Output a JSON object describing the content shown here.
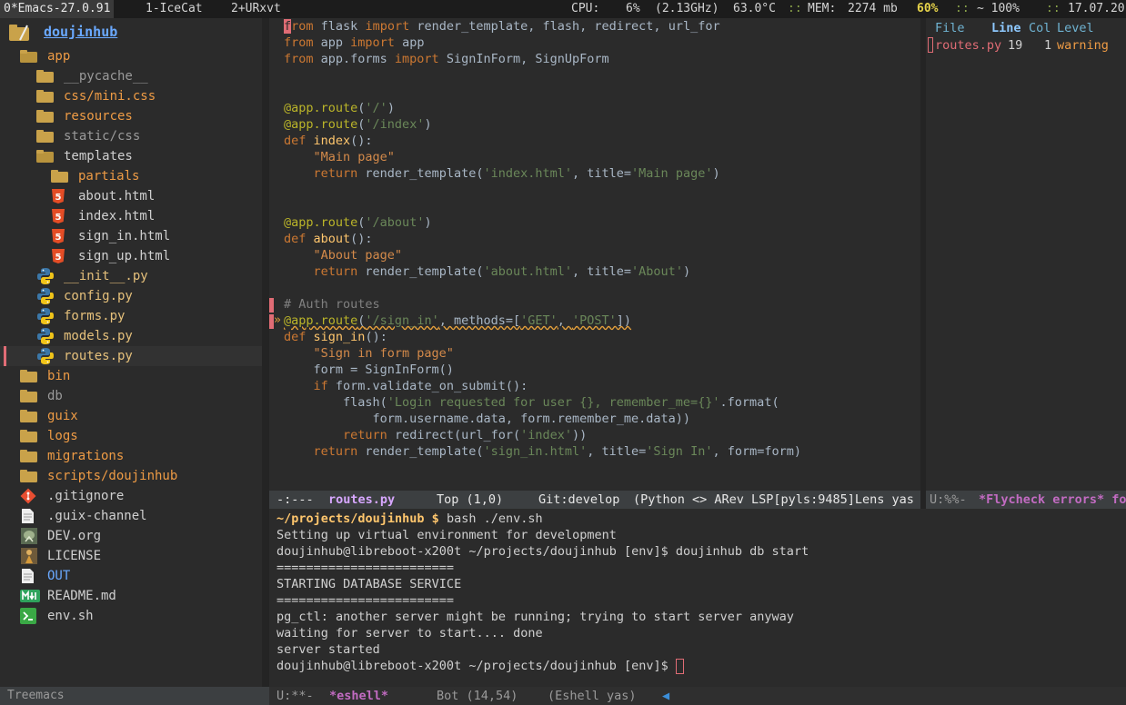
{
  "topbar": {
    "workspaces": [
      {
        "label": "0*Emacs-27.0.91",
        "active": true
      },
      {
        "label": "1-IceCat",
        "active": false
      },
      {
        "label": "2+URxvt",
        "active": false
      }
    ],
    "cpu_label": "CPU:",
    "cpu_value": "6%",
    "cpu_freq": "(2.13GHz)",
    "temp": "63.0°C",
    "mem_label": "MEM:",
    "mem_value": "2274 mb",
    "battery_value": "60%",
    "volume": "~ 100%",
    "date": "17.07.20"
  },
  "treemacs": {
    "root": "doujinhub",
    "items": [
      {
        "label": "app",
        "depth": 1,
        "icon": "folder-open-icon",
        "color": "orange"
      },
      {
        "label": "__pycache__",
        "depth": 2,
        "icon": "folder-icon",
        "color": "gray"
      },
      {
        "label": "css/mini.css",
        "depth": 2,
        "icon": "folder-icon",
        "color": "orange"
      },
      {
        "label": "resources",
        "depth": 2,
        "icon": "folder-icon",
        "color": "orange"
      },
      {
        "label": "static/css",
        "depth": 2,
        "icon": "folder-icon",
        "color": "gray"
      },
      {
        "label": "templates",
        "depth": 2,
        "icon": "folder-open-icon",
        "color": "light"
      },
      {
        "label": "partials",
        "depth": 3,
        "icon": "folder-icon",
        "color": "orange"
      },
      {
        "label": "about.html",
        "depth": 3,
        "icon": "html5-icon",
        "color": "light"
      },
      {
        "label": "index.html",
        "depth": 3,
        "icon": "html5-icon",
        "color": "light"
      },
      {
        "label": "sign_in.html",
        "depth": 3,
        "icon": "html5-icon",
        "color": "light"
      },
      {
        "label": "sign_up.html",
        "depth": 3,
        "icon": "html5-icon",
        "color": "light"
      },
      {
        "label": "__init__.py",
        "depth": 2,
        "icon": "python-icon",
        "color": "yellow"
      },
      {
        "label": "config.py",
        "depth": 2,
        "icon": "python-icon",
        "color": "yellow"
      },
      {
        "label": "forms.py",
        "depth": 2,
        "icon": "python-icon",
        "color": "yellow"
      },
      {
        "label": "models.py",
        "depth": 2,
        "icon": "python-icon",
        "color": "yellow"
      },
      {
        "label": "routes.py",
        "depth": 2,
        "icon": "python-icon",
        "color": "yellow",
        "selected": true
      },
      {
        "label": "bin",
        "depth": 1,
        "icon": "folder-icon",
        "color": "orange"
      },
      {
        "label": "db",
        "depth": 1,
        "icon": "folder-icon",
        "color": "gray"
      },
      {
        "label": "guix",
        "depth": 1,
        "icon": "folder-icon",
        "color": "orange"
      },
      {
        "label": "logs",
        "depth": 1,
        "icon": "folder-icon",
        "color": "orange"
      },
      {
        "label": "migrations",
        "depth": 1,
        "icon": "folder-icon",
        "color": "orange"
      },
      {
        "label": "scripts/doujinhub",
        "depth": 1,
        "icon": "folder-icon",
        "color": "orange"
      },
      {
        "label": ".gitignore",
        "depth": 1,
        "icon": "git-icon",
        "color": "light"
      },
      {
        "label": ".guix-channel",
        "depth": 1,
        "icon": "document-icon",
        "color": "light"
      },
      {
        "label": "DEV.org",
        "depth": 1,
        "icon": "org-icon",
        "color": "light"
      },
      {
        "label": "LICENSE",
        "depth": 1,
        "icon": "license-icon",
        "color": "light"
      },
      {
        "label": "OUT",
        "depth": 1,
        "icon": "document-icon",
        "color": "blue"
      },
      {
        "label": "README.md",
        "depth": 1,
        "icon": "markdown-icon",
        "color": "light"
      },
      {
        "label": "env.sh",
        "depth": 1,
        "icon": "terminal-icon",
        "color": "light"
      }
    ],
    "modeline": "Treemacs"
  },
  "editor": {
    "lines": [
      [
        {
          "t": "f",
          "c": "cursor"
        },
        {
          "t": "rom",
          "c": "kw"
        },
        {
          "t": " flask ",
          "c": "id"
        },
        {
          "t": "import",
          "c": "kw"
        },
        {
          "t": " render_template, flash, redirect, url_for",
          "c": "id"
        }
      ],
      [
        {
          "t": "from",
          "c": "kw"
        },
        {
          "t": " app ",
          "c": "id"
        },
        {
          "t": "import",
          "c": "kw"
        },
        {
          "t": " app",
          "c": "id"
        }
      ],
      [
        {
          "t": "from",
          "c": "kw"
        },
        {
          "t": " app.forms ",
          "c": "id"
        },
        {
          "t": "import",
          "c": "kw"
        },
        {
          "t": " SignInForm, SignUpForm",
          "c": "id"
        }
      ],
      [],
      [],
      [
        {
          "t": "@app.route",
          "c": "dec"
        },
        {
          "t": "(",
          "c": "id"
        },
        {
          "t": "'/'",
          "c": "str"
        },
        {
          "t": ")",
          "c": "id"
        }
      ],
      [
        {
          "t": "@app.route",
          "c": "dec"
        },
        {
          "t": "(",
          "c": "id"
        },
        {
          "t": "'/index'",
          "c": "str"
        },
        {
          "t": ")",
          "c": "id"
        }
      ],
      [
        {
          "t": "def",
          "c": "kw"
        },
        {
          "t": " ",
          "c": "id"
        },
        {
          "t": "index",
          "c": "fn"
        },
        {
          "t": "():",
          "c": "id"
        }
      ],
      [
        {
          "t": "    \"Main page\"",
          "c": "doc"
        }
      ],
      [
        {
          "t": "    ",
          "c": "id"
        },
        {
          "t": "return",
          "c": "kw"
        },
        {
          "t": " render_template(",
          "c": "id"
        },
        {
          "t": "'index.html'",
          "c": "str"
        },
        {
          "t": ", title=",
          "c": "id"
        },
        {
          "t": "'Main page'",
          "c": "str"
        },
        {
          "t": ")",
          "c": "id"
        }
      ],
      [],
      [],
      [
        {
          "t": "@app.route",
          "c": "dec"
        },
        {
          "t": "(",
          "c": "id"
        },
        {
          "t": "'/about'",
          "c": "str"
        },
        {
          "t": ")",
          "c": "id"
        }
      ],
      [
        {
          "t": "def",
          "c": "kw"
        },
        {
          "t": " ",
          "c": "id"
        },
        {
          "t": "about",
          "c": "fn"
        },
        {
          "t": "():",
          "c": "id"
        }
      ],
      [
        {
          "t": "    \"About page\"",
          "c": "doc"
        }
      ],
      [
        {
          "t": "    ",
          "c": "id"
        },
        {
          "t": "return",
          "c": "kw"
        },
        {
          "t": " render_template(",
          "c": "id"
        },
        {
          "t": "'about.html'",
          "c": "str"
        },
        {
          "t": ", title=",
          "c": "id"
        },
        {
          "t": "'About'",
          "c": "str"
        },
        {
          "t": ")",
          "c": "id"
        }
      ],
      [],
      [
        {
          "t": "# Auth routes",
          "c": "cmt"
        }
      ],
      [
        {
          "t": "@app.route",
          "c": "dec warn"
        },
        {
          "t": "(",
          "c": "id warn"
        },
        {
          "t": "'/sign_in'",
          "c": "str warn"
        },
        {
          "t": ", methods=[",
          "c": "id warn"
        },
        {
          "t": "'GET'",
          "c": "str warn"
        },
        {
          "t": ", ",
          "c": "id warn"
        },
        {
          "t": "'POST'",
          "c": "str warn"
        },
        {
          "t": "])",
          "c": "id warn"
        }
      ],
      [
        {
          "t": "def",
          "c": "kw"
        },
        {
          "t": " ",
          "c": "id"
        },
        {
          "t": "sign_in",
          "c": "fn"
        },
        {
          "t": "():",
          "c": "id"
        }
      ],
      [
        {
          "t": "    \"Sign in form page\"",
          "c": "doc"
        }
      ],
      [
        {
          "t": "    form = SignInForm()",
          "c": "id"
        }
      ],
      [
        {
          "t": "    ",
          "c": "id"
        },
        {
          "t": "if",
          "c": "kw"
        },
        {
          "t": " form.validate_on_submit():",
          "c": "id"
        }
      ],
      [
        {
          "t": "        flash(",
          "c": "id"
        },
        {
          "t": "'Login requested for user {}, remember_me={}'",
          "c": "str"
        },
        {
          "t": ".format(",
          "c": "id"
        }
      ],
      [
        {
          "t": "            form.username.data, form.remember_me.data))",
          "c": "id"
        }
      ],
      [
        {
          "t": "        ",
          "c": "id"
        },
        {
          "t": "return",
          "c": "kw"
        },
        {
          "t": " redirect(url_for(",
          "c": "id"
        },
        {
          "t": "'index'",
          "c": "str"
        },
        {
          "t": "))",
          "c": "id"
        }
      ],
      [
        {
          "t": "    ",
          "c": "id"
        },
        {
          "t": "return",
          "c": "kw"
        },
        {
          "t": " render_template(",
          "c": "id"
        },
        {
          "t": "'sign_in.html'",
          "c": "str"
        },
        {
          "t": ", title=",
          "c": "id"
        },
        {
          "t": "'Sign In'",
          "c": "str"
        },
        {
          "t": ", form=form)",
          "c": "id"
        }
      ]
    ],
    "modeline": {
      "status": "-:---",
      "buffer": "routes.py",
      "position": "Top (1,0)",
      "vc": "Git:develop",
      "modes": "(Python <> ARev LSP[pyls:9485]Lens yas"
    }
  },
  "flycheck": {
    "headers": {
      "file": "File",
      "line": "Line",
      "col": "Col",
      "level": "Level"
    },
    "rows": [
      {
        "file": "routes.py",
        "line": "19",
        "col": "1",
        "level": "warning"
      }
    ],
    "modeline": {
      "status": "U:%%-",
      "buffer": "*Flycheck errors* fo"
    }
  },
  "eshell": {
    "lines": [
      {
        "prompt": "~/projects/doujinhub $",
        "text": " bash ./env.sh"
      },
      {
        "text": "Setting up virtual environment for development"
      },
      {
        "text": "doujinhub@libreboot-x200t ~/projects/doujinhub [env]$ doujinhub db start"
      },
      {
        "text": "========================"
      },
      {
        "text": "STARTING DATABASE SERVICE"
      },
      {
        "text": "========================"
      },
      {
        "text": "pg_ctl: another server might be running; trying to start server anyway"
      },
      {
        "text": "waiting for server to start.... done"
      },
      {
        "text": "server started"
      },
      {
        "text": "doujinhub@libreboot-x200t ~/projects/doujinhub [env]$ ",
        "cursor": true
      }
    ],
    "modeline": {
      "status": "U:**-",
      "buffer": "*eshell*",
      "position": "Bot (14,54)",
      "modes": "(Eshell yas)"
    }
  }
}
